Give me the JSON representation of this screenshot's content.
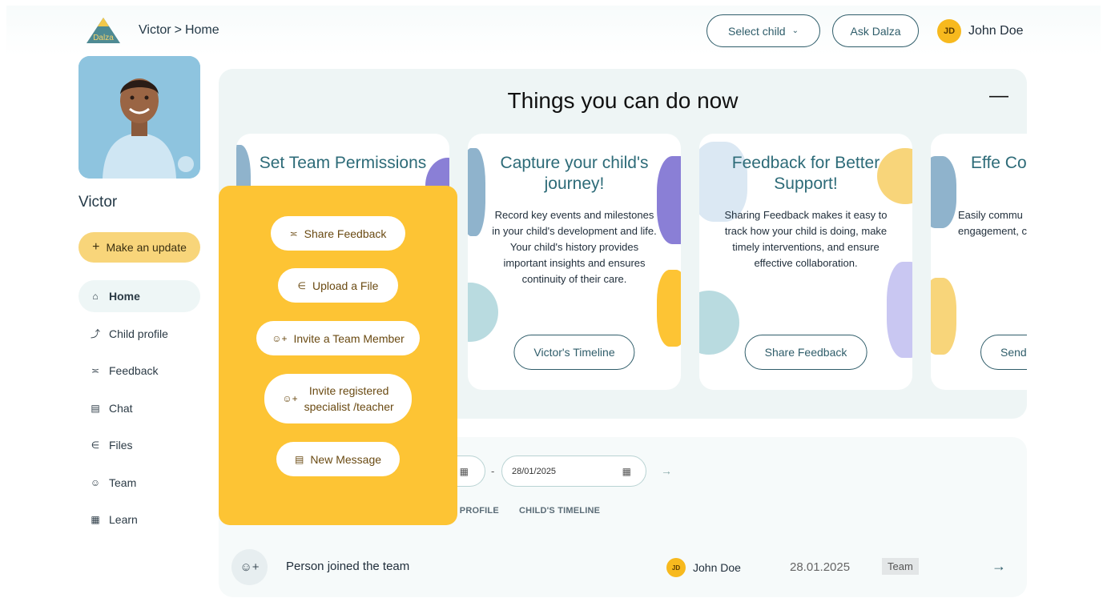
{
  "header": {
    "logo_text": "Dalza",
    "breadcrumb": {
      "child": "Victor",
      "separator": ">",
      "page": "Home"
    },
    "select_child_label": "Select child",
    "ask_dalza_label": "Ask Dalza",
    "user": {
      "initials": "JD",
      "name": "John Doe"
    }
  },
  "sidebar": {
    "child_name": "Victor",
    "make_update_label": "Make an update",
    "nav": [
      {
        "label": "Home",
        "icon": "home-icon",
        "active": true
      },
      {
        "label": "Child profile",
        "icon": "child-icon"
      },
      {
        "label": "Feedback",
        "icon": "feedback-icon"
      },
      {
        "label": "Chat",
        "icon": "chat-icon"
      },
      {
        "label": "Files",
        "icon": "paperclip-icon"
      },
      {
        "label": "Team",
        "icon": "team-icon"
      },
      {
        "label": "Learn",
        "icon": "book-icon"
      }
    ]
  },
  "things": {
    "title": "Things you can do now",
    "collapse_symbol": "—",
    "cards": [
      {
        "title": "Set Team Permissions",
        "text": "",
        "button": ""
      },
      {
        "title": "Capture your child's journey!",
        "text": "Record key events and milestones in your child's development and life. Your child's history provides important insights and ensures continuity of their care.",
        "button": "Victor's Timeline"
      },
      {
        "title": "Feedback for Better Support!",
        "text": "Sharing Feedback makes it easy to track how your child is doing, make timely interventions, and ensure effective collaboration.",
        "button": "Share Feedback"
      },
      {
        "title": "Effe Commu",
        "text": "Easily commu engagement, co-or",
        "button": "Send"
      }
    ]
  },
  "filters": {
    "date_to": "28/01/2025",
    "dash": "-",
    "tabs": [
      "S PROFILE",
      "CHILD'S TIMELINE"
    ]
  },
  "activity": [
    {
      "text": "Person joined the team",
      "user_initials": "JD",
      "user_name": "John Doe",
      "date": "28.01.2025",
      "tag": "Team"
    }
  ],
  "popup_menu": {
    "items": [
      {
        "label": "Share Feedback",
        "icon": "feedback-icon"
      },
      {
        "label": "Upload a File",
        "icon": "paperclip-icon"
      },
      {
        "label": "Invite a Team Member",
        "icon": "add-user-icon"
      },
      {
        "label_line1": "Invite registered",
        "label_line2": "specialist /teacher",
        "icon": "add-user-icon"
      },
      {
        "label": "New Message",
        "icon": "message-icon"
      }
    ]
  },
  "colors": {
    "accent_yellow": "#fdc434",
    "teal": "#2d6b78",
    "panel_bg": "#eef5f5"
  }
}
